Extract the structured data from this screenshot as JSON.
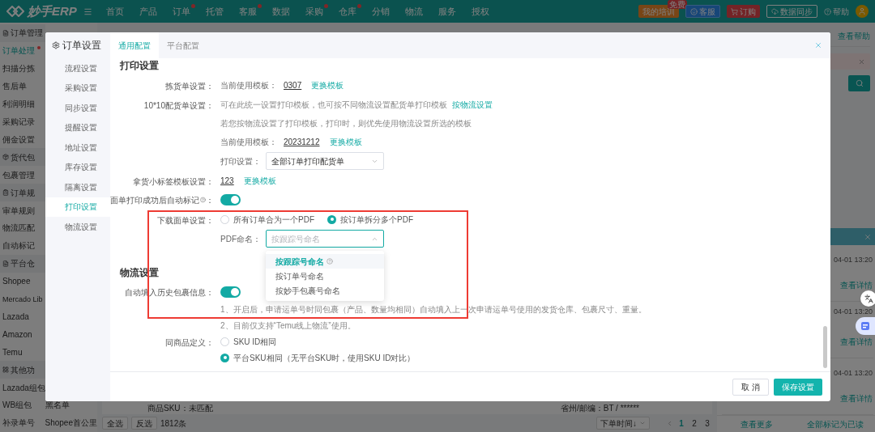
{
  "top_bar": {
    "logo": "妙手ERP",
    "nav": [
      {
        "label": "首页",
        "dot": false
      },
      {
        "label": "产品",
        "dot": false
      },
      {
        "label": "订单",
        "dot": true
      },
      {
        "label": "托管",
        "dot": false
      },
      {
        "label": "客服",
        "dot": true
      },
      {
        "label": "数据",
        "dot": false
      },
      {
        "label": "采购",
        "dot": true
      },
      {
        "label": "仓库",
        "dot": true
      },
      {
        "label": "分销",
        "dot": false
      },
      {
        "label": "物流",
        "dot": false
      },
      {
        "label": "服务",
        "dot": false
      },
      {
        "label": "授权",
        "dot": false
      }
    ],
    "actions": [
      {
        "kind": "training",
        "label": "我的培训",
        "badge": "免费"
      },
      {
        "kind": "service",
        "label": "客服"
      },
      {
        "kind": "order",
        "label": "订购"
      },
      {
        "kind": "sync",
        "label": "数据同步"
      },
      {
        "kind": "help",
        "label": "帮助"
      }
    ]
  },
  "sidebar": [
    {
      "kind": "group",
      "label": "订单管理"
    },
    {
      "kind": "item",
      "label": "订单处理",
      "selected": true,
      "dot": true
    },
    {
      "kind": "item",
      "label": "扫描分拣",
      "selected": false
    },
    {
      "kind": "item",
      "label": "售后单",
      "selected": false
    },
    {
      "kind": "item",
      "label": "利润明细",
      "selected": false
    },
    {
      "kind": "item",
      "label": "采购记录",
      "selected": false
    },
    {
      "kind": "item",
      "label": "佣金设置",
      "selected": false
    },
    {
      "kind": "group",
      "label": "货代包"
    },
    {
      "kind": "item",
      "label": "包裹管理",
      "selected": false
    },
    {
      "kind": "group",
      "label": "订单规"
    },
    {
      "kind": "item",
      "label": "审单规则",
      "selected": false
    },
    {
      "kind": "item",
      "label": "物流匹配",
      "selected": false
    },
    {
      "kind": "item",
      "label": "自动标记",
      "selected": false
    },
    {
      "kind": "group",
      "label": "平台仓"
    },
    {
      "kind": "item",
      "label": "Shopee",
      "selected": false
    },
    {
      "kind": "item",
      "label": "Mercado Lib",
      "selected": false
    },
    {
      "kind": "item",
      "label": "Lazada",
      "selected": false
    },
    {
      "kind": "item",
      "label": "Amazon",
      "selected": false
    },
    {
      "kind": "item",
      "label": "Temu",
      "selected": false
    },
    {
      "kind": "group",
      "label": "其他功"
    },
    {
      "kind": "item",
      "label": "Lazada组包",
      "selected": false
    },
    {
      "kind": "item",
      "label": "WB组包",
      "second": "黑名单",
      "selected": false
    },
    {
      "kind": "item",
      "label": "补录单号",
      "second": "Shopee首公里",
      "selected": false
    }
  ],
  "page": {
    "help_link": "查看帮助",
    "row_fragment": {
      "sku": "商品SKU：未匹配",
      "region": "省州/邮编：BT / ******"
    },
    "toolbar": {
      "select_all": "全选",
      "invert": "反选",
      "count": "1812条",
      "sort": "下单时间↓",
      "pages": [
        {
          "label": "1",
          "selected": true
        },
        {
          "label": "2",
          "selected": false
        },
        {
          "label": "3",
          "selected": false
        }
      ]
    },
    "notifications": [
      {
        "time": "04-01 13:20",
        "link": "查看详情"
      },
      {
        "time": "04-01 13:20",
        "link": "查看详情"
      },
      {
        "time": "04-01 13:20",
        "link": "查看详情"
      }
    ],
    "view_more": "查看更多",
    "mark_all_read": "全部标记为已读"
  },
  "modal": {
    "title": "订单设置",
    "nav": [
      {
        "label": "流程设置",
        "selected": false
      },
      {
        "label": "采购设置",
        "selected": false
      },
      {
        "label": "同步设置",
        "selected": false
      },
      {
        "label": "提醒设置",
        "selected": false
      },
      {
        "label": "地址设置",
        "selected": false
      },
      {
        "label": "库存设置",
        "selected": false
      },
      {
        "label": "隔离设置",
        "selected": false
      },
      {
        "label": "打印设置",
        "selected": true
      },
      {
        "label": "物流设置",
        "selected": false
      }
    ],
    "tabs": [
      {
        "label": "通用配置",
        "selected": true
      },
      {
        "label": "平台配置",
        "selected": false
      }
    ],
    "sections": [
      {
        "title": "打印设置",
        "rows": [
          {
            "kind": "template",
            "label": "拣货单设置：",
            "prefix": "当前使用模板：",
            "value": "0307",
            "link": "更换模板"
          },
          {
            "kind": "text_link",
            "label": "10*10配货单设置：",
            "text": "可在此统一设置打印模板，也可按不同物流设置配货单打印模板",
            "link": "按物流设置"
          },
          {
            "kind": "note",
            "text": "若您按物流设置了打印模板，打印时，则优先使用物流设置所选的模板"
          },
          {
            "kind": "template",
            "prefix": "当前使用模板：",
            "value": "20231212",
            "link": "更换模板"
          },
          {
            "kind": "select",
            "prefix": "打印设置：",
            "value": "全部订单打印配货单",
            "open": false
          },
          {
            "kind": "template",
            "label": "拿货小标签模板设置：",
            "value": "123",
            "link": "更换模板"
          },
          {
            "kind": "toggle",
            "label": "面单打印成功后自动标记",
            "help": true,
            "colon": "：",
            "on": true
          },
          {
            "kind": "radio",
            "label": "下载面单设置：",
            "options": [
              {
                "label": "所有订单合为一个PDF",
                "selected": false
              },
              {
                "label": "按订单拆分多个PDF",
                "selected": true
              }
            ]
          },
          {
            "kind": "select",
            "prefix": "PDF命名：",
            "placeholder": "按跟踪号命名",
            "open": true,
            "options": [
              {
                "label": "按跟踪号命名",
                "selected": true,
                "help": true
              },
              {
                "label": "按订单号命名",
                "selected": false,
                "help": false
              },
              {
                "label": "按妙手包裹号命名",
                "selected": false,
                "help": false
              }
            ]
          }
        ]
      },
      {
        "title": "物流设置",
        "rows": [
          {
            "kind": "toggle",
            "label": "自动填入历史包裹信息：",
            "help": false,
            "on": true
          },
          {
            "kind": "note",
            "text": "1、开启后，申请运单号时同包裹（产品、数量均相同）自动填入上一次申请运单号使用的发货仓库、包裹尺寸、重量。"
          },
          {
            "kind": "note",
            "text": "2、目前仅支持“Temu线上物流”使用。"
          },
          {
            "kind": "radio_list",
            "label": "同商品定义：",
            "options": [
              {
                "label": "SKU ID相同",
                "selected": false
              },
              {
                "label": "平台SKU相同（无平台SKU时，使用SKU ID对比）",
                "selected": true
              }
            ]
          }
        ]
      }
    ],
    "footer": {
      "cancel": "取 消",
      "save": "保存设置"
    }
  }
}
